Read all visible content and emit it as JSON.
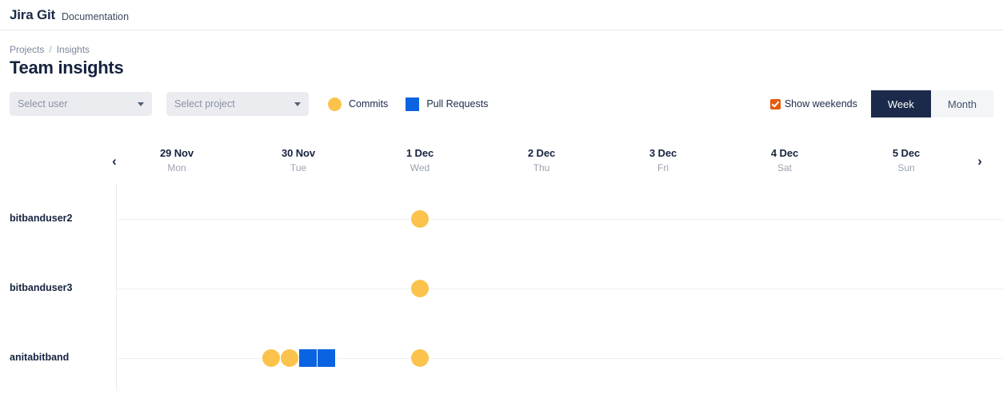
{
  "topbar": {
    "brand": "Jira Git",
    "brand_sub": "Documentation"
  },
  "breadcrumb": {
    "projects": "Projects",
    "separator": "/",
    "current": "Insights"
  },
  "page_title": "Team insights",
  "toolbar": {
    "user_select_placeholder": "Select user",
    "project_select_placeholder": "Select project",
    "legend": [
      {
        "label": "Commits",
        "shape": "circle",
        "color": "#FBC34B",
        "icon": "commit-dot-icon"
      },
      {
        "label": "Pull Requests",
        "shape": "square",
        "color": "#0A63E0",
        "icon": "pull-request-square-icon"
      }
    ],
    "show_weekends_label": "Show weekends",
    "show_weekends_checked": true,
    "checkbox_color": "#E8590C",
    "range_week": "Week",
    "range_month": "Month",
    "range_active": "Week"
  },
  "calendar": {
    "prev_label": "‹",
    "next_label": "›",
    "days": [
      {
        "date": "29 Nov",
        "weekday": "Mon"
      },
      {
        "date": "30 Nov",
        "weekday": "Tue"
      },
      {
        "date": "1 Dec",
        "weekday": "Wed"
      },
      {
        "date": "2 Dec",
        "weekday": "Thu"
      },
      {
        "date": "3 Dec",
        "weekday": "Fri"
      },
      {
        "date": "4 Dec",
        "weekday": "Sat"
      },
      {
        "date": "5 Dec",
        "weekday": "Sun"
      }
    ]
  },
  "chart_data": {
    "type": "scatter",
    "title": "Team insights",
    "xlabel": "",
    "ylabel": "",
    "categories": [
      "29 Nov",
      "30 Nov",
      "1 Dec",
      "2 Dec",
      "3 Dec",
      "4 Dec",
      "5 Dec"
    ],
    "legend": [
      "Commits",
      "Pull Requests"
    ],
    "legend_position": "top-left",
    "grid": true,
    "rows": [
      {
        "user": "bitbanduser2",
        "cells": [
          {
            "day": "29 Nov",
            "commits": 0,
            "pull_requests": 0
          },
          {
            "day": "30 Nov",
            "commits": 0,
            "pull_requests": 0
          },
          {
            "day": "1 Dec",
            "commits": 1,
            "pull_requests": 0
          },
          {
            "day": "2 Dec",
            "commits": 0,
            "pull_requests": 0
          },
          {
            "day": "3 Dec",
            "commits": 0,
            "pull_requests": 0
          },
          {
            "day": "4 Dec",
            "commits": 0,
            "pull_requests": 0
          },
          {
            "day": "5 Dec",
            "commits": 0,
            "pull_requests": 0
          }
        ]
      },
      {
        "user": "bitbanduser3",
        "cells": [
          {
            "day": "29 Nov",
            "commits": 0,
            "pull_requests": 0
          },
          {
            "day": "30 Nov",
            "commits": 0,
            "pull_requests": 0
          },
          {
            "day": "1 Dec",
            "commits": 1,
            "pull_requests": 0
          },
          {
            "day": "2 Dec",
            "commits": 0,
            "pull_requests": 0
          },
          {
            "day": "3 Dec",
            "commits": 0,
            "pull_requests": 0
          },
          {
            "day": "4 Dec",
            "commits": 0,
            "pull_requests": 0
          },
          {
            "day": "5 Dec",
            "commits": 0,
            "pull_requests": 0
          }
        ]
      },
      {
        "user": "anitabitband",
        "cells": [
          {
            "day": "29 Nov",
            "commits": 0,
            "pull_requests": 0
          },
          {
            "day": "30 Nov",
            "commits": 2,
            "pull_requests": 2
          },
          {
            "day": "1 Dec",
            "commits": 1,
            "pull_requests": 0
          },
          {
            "day": "2 Dec",
            "commits": 0,
            "pull_requests": 0
          },
          {
            "day": "3 Dec",
            "commits": 0,
            "pull_requests": 0
          },
          {
            "day": "4 Dec",
            "commits": 0,
            "pull_requests": 0
          },
          {
            "day": "5 Dec",
            "commits": 0,
            "pull_requests": 0
          }
        ]
      }
    ]
  }
}
